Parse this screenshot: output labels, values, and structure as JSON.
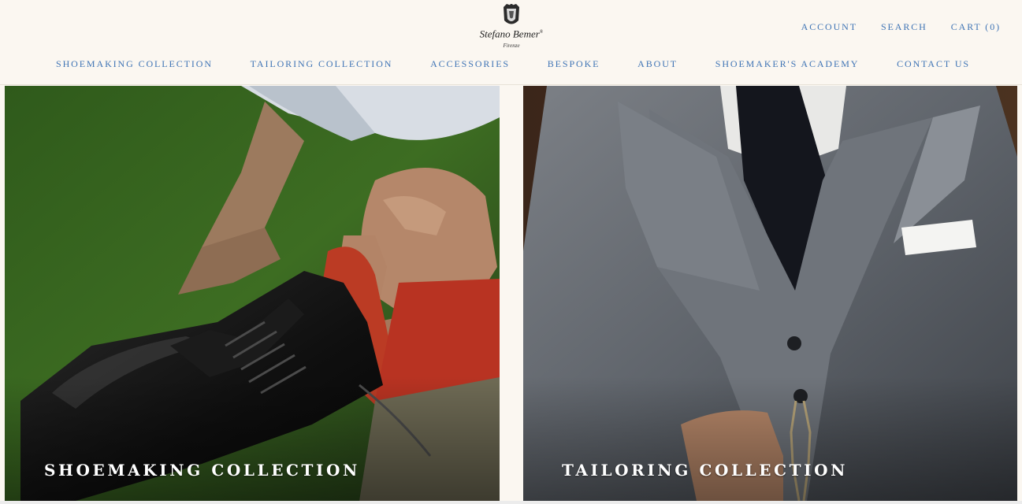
{
  "brand": {
    "name": "Stefano Bemer",
    "mark": "®",
    "city": "Firenze"
  },
  "top_nav": [
    "ACCOUNT",
    "SEARCH",
    "CART (0)"
  ],
  "main_nav": [
    "SHOEMAKING COLLECTION",
    "TAILORING COLLECTION",
    "ACCESSORIES",
    "BESPOKE",
    "ABOUT",
    "SHOEMAKER'S ACADEMY",
    "CONTACT US"
  ],
  "collections": {
    "left": {
      "title": "SHOEMAKING COLLECTION",
      "image": "shoe-lacing-photo"
    },
    "right": {
      "title": "TAILORING COLLECTION",
      "image": "grey-suit-photo"
    }
  },
  "colors": {
    "background": "#fbf7f1",
    "link": "#3f74b5"
  }
}
